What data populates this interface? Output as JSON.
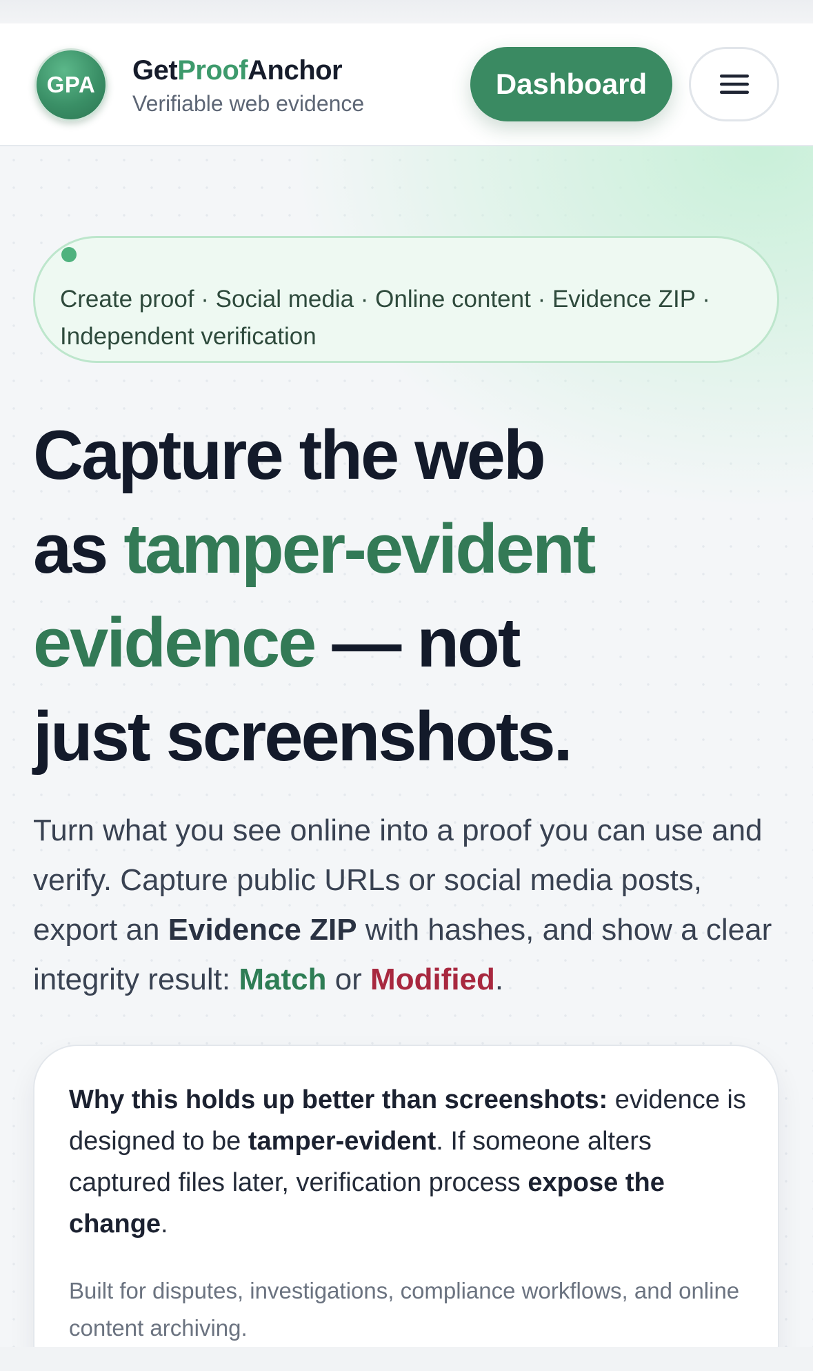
{
  "header": {
    "logo_text": "GPA",
    "brand_prefix": "Get",
    "brand_accent": "Proof",
    "brand_suffix": "Anchor",
    "tagline": "Verifiable web evidence",
    "dashboard_label": "Dashboard",
    "menu_icon": "hamburger-menu-icon"
  },
  "hero": {
    "pill_text": "Create proof · Social media · Online content · Evidence ZIP · Independent verification",
    "headline": {
      "line1": "Capture the web",
      "line2_a": "as ",
      "line2_green": "tamper-evident",
      "line3_green": "evidence",
      "line3_b": " — not",
      "line4": "just screenshots."
    },
    "intro": {
      "part1": "Turn what you see online into a proof you can use and verify. Capture public URLs or social media posts, export an ",
      "bold1": "Evidence ZIP",
      "part2": " with hashes, and show a clear integrity result: ",
      "match": "Match",
      "or": " or ",
      "modified": "Modified",
      "end": "."
    }
  },
  "card": {
    "lead_bold": "Why this holds up better than screenshots:",
    "text1": " evidence is designed to be ",
    "bold2": "tamper-evident",
    "text2": ". If someone alters captured files later, verification process ",
    "bold3": "expose the change",
    "text3": ".",
    "sub": "Built for disputes, investigations, compliance workflows, and online content archiving."
  },
  "colors": {
    "brand_green": "#3a8a62",
    "headline_green": "#337a56",
    "match_green": "#2e7d55",
    "modified_red": "#a8283f"
  }
}
